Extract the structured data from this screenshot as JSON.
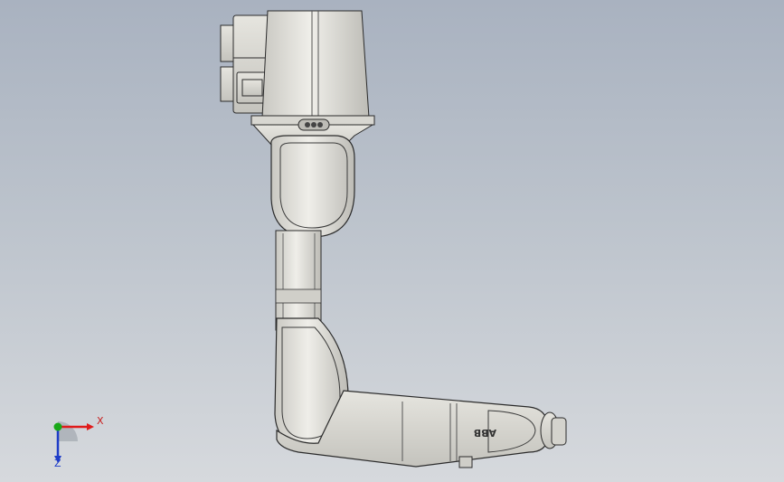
{
  "viewport": {
    "background_top": "#a9b2c0",
    "background_bottom": "#d6d9dd"
  },
  "model": {
    "body_color": "#dcdbd5",
    "edge_color": "#2b2b2b",
    "logo_text": "ABB"
  },
  "triad": {
    "x_label": "X",
    "z_label": "Z",
    "x_color": "#e01b1b",
    "y_color": "#18a818",
    "z_color": "#1e3cc8"
  }
}
